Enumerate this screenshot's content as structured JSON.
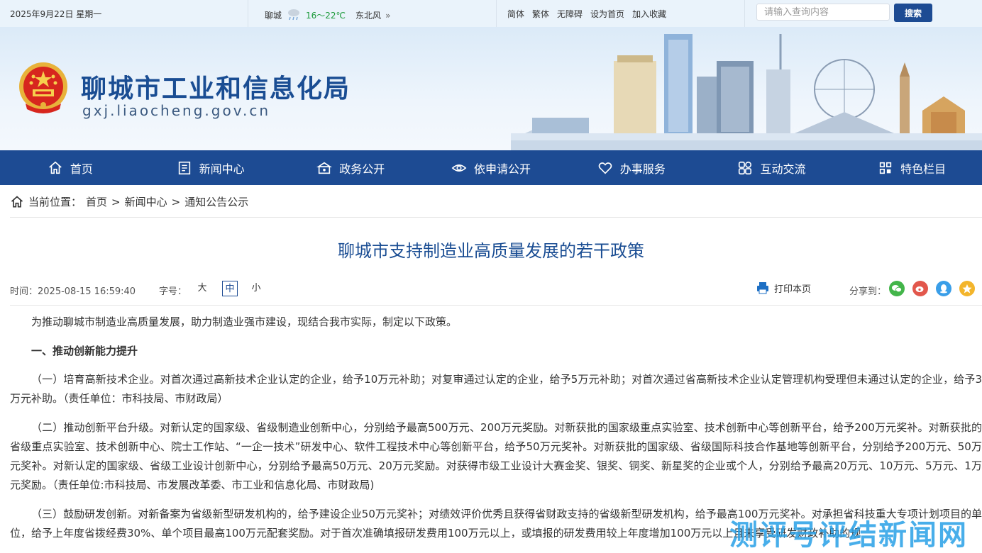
{
  "topbar": {
    "date": "2025年9月22日 星期一",
    "city": "聊城",
    "temp": "16～22℃",
    "wind": "东北风",
    "links": [
      "简体",
      "繁体",
      "无障碍",
      "设为首页",
      "加入收藏"
    ],
    "search_placeholder": "请输入查询内容",
    "search_button": "搜索"
  },
  "header": {
    "title": "聊城市工业和信息化局",
    "domain": "gxj.liaocheng.gov.cn"
  },
  "nav": [
    {
      "label": "首页",
      "icon": "home-icon"
    },
    {
      "label": "新闻中心",
      "icon": "news-icon"
    },
    {
      "label": "政务公开",
      "icon": "gov-icon"
    },
    {
      "label": "依申请公开",
      "icon": "eye-icon"
    },
    {
      "label": "办事服务",
      "icon": "heart-icon"
    },
    {
      "label": "互动交流",
      "icon": "interact-icon"
    },
    {
      "label": "特色栏目",
      "icon": "grid-icon"
    }
  ],
  "breadcrumb": {
    "label": "当前位置：",
    "items": [
      "首页",
      "新闻中心",
      "通知公告公示"
    ],
    "separator": ">"
  },
  "article": {
    "title": "聊城市支持制造业高质量发展的若干政策",
    "time": "时间：2025-08-15 16:59:40",
    "font_size_label": "字号：",
    "font_sizes": [
      "大",
      "中",
      "小"
    ],
    "print": "打印本页",
    "share_label": "分享到：",
    "paragraphs": [
      "为推动聊城市制造业高质量发展，助力制造业强市建设，现结合我市实际，制定以下政策。",
      "一、推动创新能力提升",
      "（一）培育高新技术企业。对首次通过高新技术企业认定的企业，给予10万元补助；对复审通过认定的企业，给予5万元补助；对首次通过省高新技术企业认定管理机构受理但未通过认定的企业，给予3万元补助。（责任单位：市科技局、市财政局）",
      "（二）推动创新平台升级。对新认定的国家级、省级制造业创新中心，分别给予最高500万元、200万元奖励。对新获批的国家级重点实验室、技术创新中心等创新平台，给予200万元奖补。对新获批的省级重点实验室、技术创新中心、院士工作站、“一企一技术”研发中心、软件工程技术中心等创新平台，给予50万元奖补。对新获批的国家级、省级国际科技合作基地等创新平台，分别给予200万元、50万元奖补。对新认定的国家级、省级工业设计创新中心，分别给予最高50万元、20万元奖励。对获得市级工业设计大赛金奖、银奖、铜奖、新星奖的企业或个人，分别给予最高20万元、10万元、5万元、1万元奖励。（责任单位:市科技局、市发展改革委、市工业和信息化局、市财政局)",
      "（三）鼓励研发创新。对新备案为省级新型研发机构的，给予建设企业50万元奖补；对绩效评价优秀且获得省财政支持的省级新型研发机构，给予最高100万元奖补。对承担省科技重大专项计划项目的单位，给予上年度省拨经费30%、单个项目最高100万元配套奖励。对于首次准确填报研发费用100万元以上，或填报的研发费用较上年度增加100万元以上且未享受研发财政补助的规"
    ]
  },
  "watermark": "测评号评结新闻网"
}
